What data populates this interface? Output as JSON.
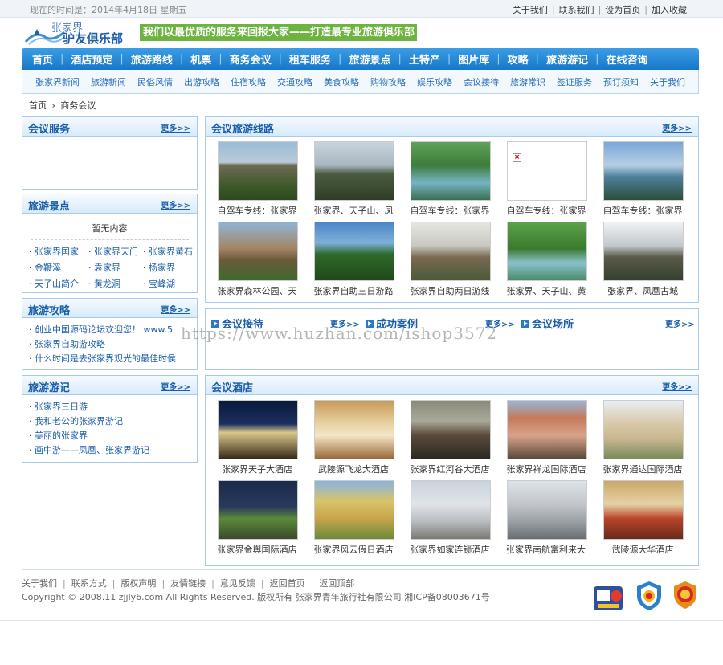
{
  "topbar": {
    "date": "现在的时间是：2014年4月18日 星期五",
    "links": [
      "关于我们",
      "联系我们",
      "设为首页",
      "加入收藏"
    ]
  },
  "logo": {
    "line1": "张家界",
    "line2": "驴友俱乐部"
  },
  "slogan": "我们以最优质的服务来回报大家——打造最专业旅游俱乐部",
  "nav": [
    "首页",
    "酒店预定",
    "旅游路线",
    "机票",
    "商务会议",
    "租车服务",
    "旅游景点",
    "土特产",
    "图片库",
    "攻略",
    "旅游游记",
    "在线咨询"
  ],
  "subnav": [
    "张家界新闻",
    "旅游新闻",
    "民俗风情",
    "出游攻略",
    "住宿攻略",
    "交通攻略",
    "美食攻略",
    "购物攻略",
    "娱乐攻略",
    "会议接待",
    "旅游常识",
    "签证服务",
    "预订须知",
    "关于我们"
  ],
  "breadcrumb": {
    "home": "首页",
    "arrow": "›",
    "current": "商务会议"
  },
  "more": "更多>>",
  "side": {
    "meeting_service": {
      "title": "会议服务"
    },
    "scenic": {
      "title": "旅游景点",
      "empty": "暂无内容",
      "items": [
        "张家界国家",
        "张家界天门",
        "张家界黄石",
        "金鞭溪",
        "袁家界",
        "杨家界",
        "天子山简介",
        "黄龙洞",
        "宝峰湖"
      ]
    },
    "guides": {
      "title": "旅游攻略",
      "items": [
        "创业中国源码论坛欢迎您！ www.5",
        "张家界自助游攻略",
        "什么时间是去张家界观光的最佳时侯"
      ]
    },
    "travelogue": {
      "title": "旅游游记",
      "items": [
        "张家界三日游",
        "我和老公的张家界游记",
        "美丽的张家界",
        "画中游——凤凰、张家界游记"
      ]
    }
  },
  "routes": {
    "title": "会议旅游线路",
    "items": [
      {
        "caption": "自驾车专线：张家界",
        "img": "mountain-peaks"
      },
      {
        "caption": "张家界、天子山、凤",
        "img": "misty-peaks"
      },
      {
        "caption": "自驾车专线：张家界",
        "img": "river-valley"
      },
      {
        "caption": "自驾车专线：张家界",
        "img": "broken-image"
      },
      {
        "caption": "自驾车专线：张家界",
        "img": "cable-car"
      },
      {
        "caption": "张家界森林公园、天",
        "img": "pillar-peak"
      },
      {
        "caption": "张家界自助三日游路",
        "img": "green-peaks"
      },
      {
        "caption": "张家界自助两日游线",
        "img": "fog-pillars"
      },
      {
        "caption": "张家界、天子山、黄",
        "img": "stream"
      },
      {
        "caption": "张家界、凤凰古城",
        "img": "cloud-sea"
      }
    ]
  },
  "tri": {
    "reception": "会议接待",
    "cases": "成功案例",
    "venues": "会议场所"
  },
  "watermark": "https://www.huzhan.com/ishop3572",
  "hotels": {
    "title": "会议酒店",
    "items": [
      {
        "caption": "张家界天子大酒店",
        "img": "hotel-night"
      },
      {
        "caption": "武陵源飞龙大酒店",
        "img": "hotel-lobby"
      },
      {
        "caption": "张家界红河谷大酒店",
        "img": "hotel-valley"
      },
      {
        "caption": "张家界祥龙国际酒店",
        "img": "hotel-tower"
      },
      {
        "caption": "张家界通达国际酒店",
        "img": "hotel-flags"
      },
      {
        "caption": "张家界金舆国际酒店",
        "img": "hotel-evening"
      },
      {
        "caption": "张家界风云假日酒店",
        "img": "hotel-yellow"
      },
      {
        "caption": "张家界如家连锁酒店",
        "img": "hotel-white"
      },
      {
        "caption": "张家界南航富利来大酒店",
        "img": "hotel-grey"
      },
      {
        "caption": "武陵源大华酒店",
        "img": "hotel-restaurant"
      }
    ]
  },
  "footer": {
    "links": [
      "关于我们",
      "联系方式",
      "版权声明",
      "友情链接",
      "意见反馈",
      "返回首页",
      "返回顶部"
    ],
    "copyright": "Copyright © 2008.11 zjjly6.com  All Rights Reserved.  版权所有 张家界青年旅行社有限公司  湘ICP备08003671号"
  }
}
